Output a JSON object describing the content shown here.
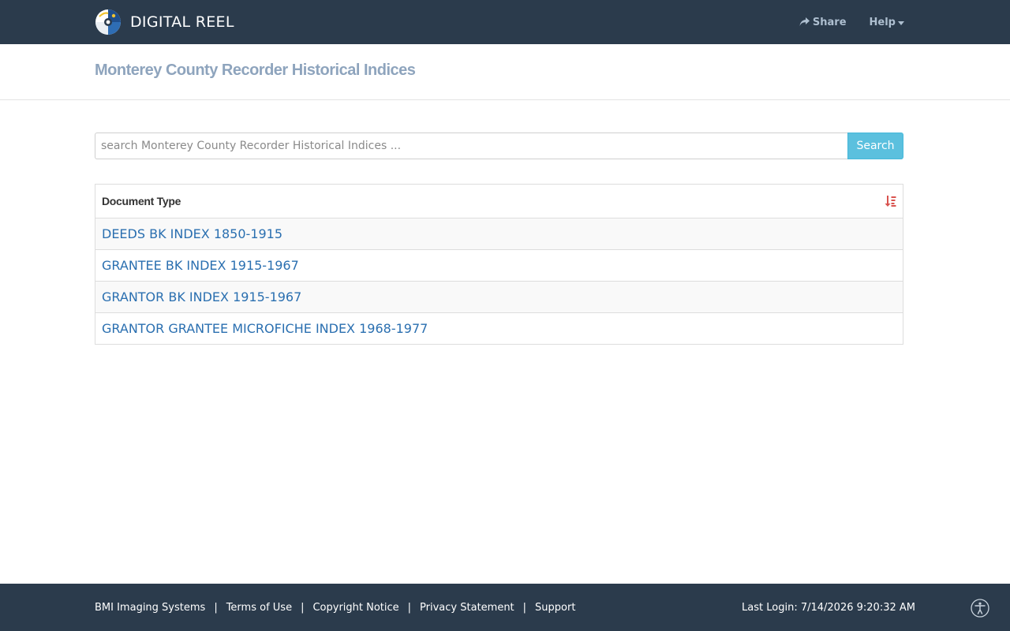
{
  "navbar": {
    "brand": "DIGITAL REEL",
    "share_label": "Share",
    "help_label": "Help"
  },
  "page": {
    "title": "Monterey County Recorder Historical Indices"
  },
  "search": {
    "placeholder": "search Monterey County Recorder Historical Indices ...",
    "value": "",
    "button_label": "Search"
  },
  "table": {
    "column_header": "Document Type",
    "sort_icon": "sort-alpha-desc-icon",
    "rows": [
      "DEEDS BK INDEX 1850-1915",
      "GRANTEE BK INDEX 1915-1967",
      "GRANTOR BK INDEX 1915-1967",
      "GRANTOR GRANTEE MICROFICHE INDEX 1968-1977"
    ]
  },
  "footer": {
    "links": [
      "BMI Imaging Systems",
      "Terms of Use",
      "Copyright Notice",
      "Privacy Statement",
      "Support"
    ],
    "separator": "|",
    "last_login": "Last Login: 7/14/2026 9:20:32 AM"
  },
  "colors": {
    "navbar_bg": "#2b3b4c",
    "accent_button": "#5bc0de",
    "link": "#2a6fb0",
    "title": "#8ea4bd",
    "sort_icon": "#d9534f"
  }
}
